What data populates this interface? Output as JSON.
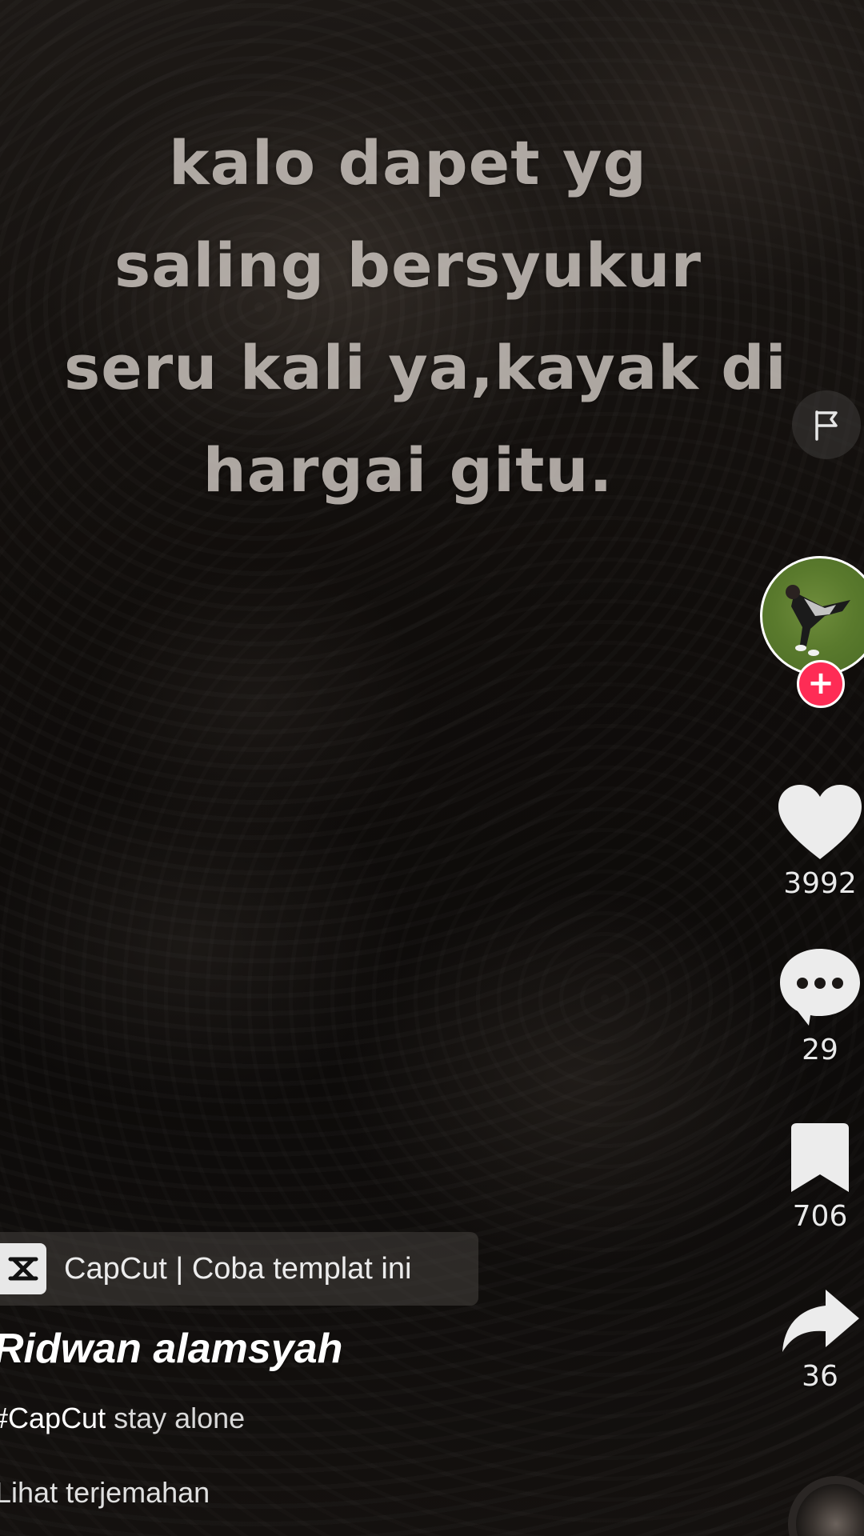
{
  "video": {
    "overlay_text_lines": [
      "kalo dapet yg",
      "saling bersyukur",
      "seru kali ya,kayak di",
      "hargai gitu."
    ]
  },
  "rail": {
    "report_icon": "flag-icon",
    "follow_icon": "plus-icon",
    "like": {
      "icon": "heart-icon",
      "count": "3992"
    },
    "comment": {
      "icon": "comment-bubble-icon",
      "count": "29"
    },
    "bookmark": {
      "icon": "bookmark-icon",
      "count": "706"
    },
    "share": {
      "icon": "share-arrow-icon",
      "count": "36"
    }
  },
  "capcut": {
    "icon": "capcut-logo-icon",
    "label": "CapCut | Coba templat ini"
  },
  "post": {
    "username": "Ridwan alamsyah",
    "hashtag": "#CapCut",
    "caption_text": " stay alone",
    "translate_link": "Lihat terjemahan"
  },
  "colors": {
    "accent_red": "#fe2c55",
    "icon_white": "#ececec"
  }
}
